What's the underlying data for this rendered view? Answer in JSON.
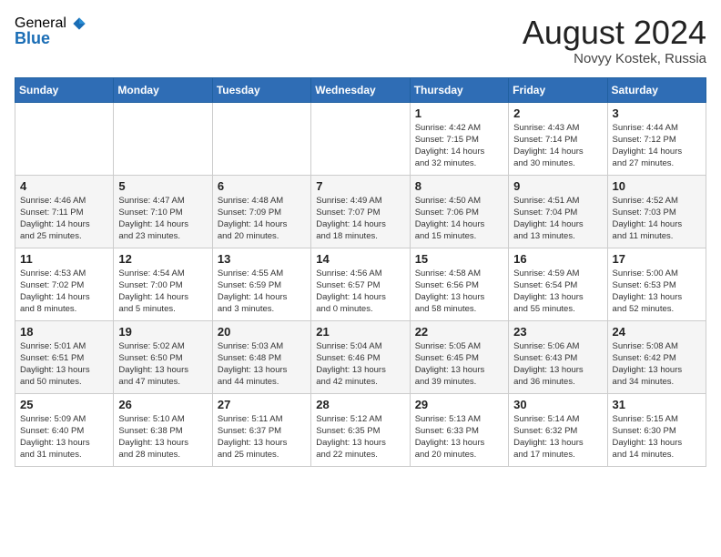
{
  "header": {
    "logo_general": "General",
    "logo_blue": "Blue",
    "month_year": "August 2024",
    "location": "Novyy Kostek, Russia"
  },
  "days_of_week": [
    "Sunday",
    "Monday",
    "Tuesday",
    "Wednesday",
    "Thursday",
    "Friday",
    "Saturday"
  ],
  "weeks": [
    [
      {
        "day": "",
        "detail": ""
      },
      {
        "day": "",
        "detail": ""
      },
      {
        "day": "",
        "detail": ""
      },
      {
        "day": "",
        "detail": ""
      },
      {
        "day": "1",
        "detail": "Sunrise: 4:42 AM\nSunset: 7:15 PM\nDaylight: 14 hours\nand 32 minutes."
      },
      {
        "day": "2",
        "detail": "Sunrise: 4:43 AM\nSunset: 7:14 PM\nDaylight: 14 hours\nand 30 minutes."
      },
      {
        "day": "3",
        "detail": "Sunrise: 4:44 AM\nSunset: 7:12 PM\nDaylight: 14 hours\nand 27 minutes."
      }
    ],
    [
      {
        "day": "4",
        "detail": "Sunrise: 4:46 AM\nSunset: 7:11 PM\nDaylight: 14 hours\nand 25 minutes."
      },
      {
        "day": "5",
        "detail": "Sunrise: 4:47 AM\nSunset: 7:10 PM\nDaylight: 14 hours\nand 23 minutes."
      },
      {
        "day": "6",
        "detail": "Sunrise: 4:48 AM\nSunset: 7:09 PM\nDaylight: 14 hours\nand 20 minutes."
      },
      {
        "day": "7",
        "detail": "Sunrise: 4:49 AM\nSunset: 7:07 PM\nDaylight: 14 hours\nand 18 minutes."
      },
      {
        "day": "8",
        "detail": "Sunrise: 4:50 AM\nSunset: 7:06 PM\nDaylight: 14 hours\nand 15 minutes."
      },
      {
        "day": "9",
        "detail": "Sunrise: 4:51 AM\nSunset: 7:04 PM\nDaylight: 14 hours\nand 13 minutes."
      },
      {
        "day": "10",
        "detail": "Sunrise: 4:52 AM\nSunset: 7:03 PM\nDaylight: 14 hours\nand 11 minutes."
      }
    ],
    [
      {
        "day": "11",
        "detail": "Sunrise: 4:53 AM\nSunset: 7:02 PM\nDaylight: 14 hours\nand 8 minutes."
      },
      {
        "day": "12",
        "detail": "Sunrise: 4:54 AM\nSunset: 7:00 PM\nDaylight: 14 hours\nand 5 minutes."
      },
      {
        "day": "13",
        "detail": "Sunrise: 4:55 AM\nSunset: 6:59 PM\nDaylight: 14 hours\nand 3 minutes."
      },
      {
        "day": "14",
        "detail": "Sunrise: 4:56 AM\nSunset: 6:57 PM\nDaylight: 14 hours\nand 0 minutes."
      },
      {
        "day": "15",
        "detail": "Sunrise: 4:58 AM\nSunset: 6:56 PM\nDaylight: 13 hours\nand 58 minutes."
      },
      {
        "day": "16",
        "detail": "Sunrise: 4:59 AM\nSunset: 6:54 PM\nDaylight: 13 hours\nand 55 minutes."
      },
      {
        "day": "17",
        "detail": "Sunrise: 5:00 AM\nSunset: 6:53 PM\nDaylight: 13 hours\nand 52 minutes."
      }
    ],
    [
      {
        "day": "18",
        "detail": "Sunrise: 5:01 AM\nSunset: 6:51 PM\nDaylight: 13 hours\nand 50 minutes."
      },
      {
        "day": "19",
        "detail": "Sunrise: 5:02 AM\nSunset: 6:50 PM\nDaylight: 13 hours\nand 47 minutes."
      },
      {
        "day": "20",
        "detail": "Sunrise: 5:03 AM\nSunset: 6:48 PM\nDaylight: 13 hours\nand 44 minutes."
      },
      {
        "day": "21",
        "detail": "Sunrise: 5:04 AM\nSunset: 6:46 PM\nDaylight: 13 hours\nand 42 minutes."
      },
      {
        "day": "22",
        "detail": "Sunrise: 5:05 AM\nSunset: 6:45 PM\nDaylight: 13 hours\nand 39 minutes."
      },
      {
        "day": "23",
        "detail": "Sunrise: 5:06 AM\nSunset: 6:43 PM\nDaylight: 13 hours\nand 36 minutes."
      },
      {
        "day": "24",
        "detail": "Sunrise: 5:08 AM\nSunset: 6:42 PM\nDaylight: 13 hours\nand 34 minutes."
      }
    ],
    [
      {
        "day": "25",
        "detail": "Sunrise: 5:09 AM\nSunset: 6:40 PM\nDaylight: 13 hours\nand 31 minutes."
      },
      {
        "day": "26",
        "detail": "Sunrise: 5:10 AM\nSunset: 6:38 PM\nDaylight: 13 hours\nand 28 minutes."
      },
      {
        "day": "27",
        "detail": "Sunrise: 5:11 AM\nSunset: 6:37 PM\nDaylight: 13 hours\nand 25 minutes."
      },
      {
        "day": "28",
        "detail": "Sunrise: 5:12 AM\nSunset: 6:35 PM\nDaylight: 13 hours\nand 22 minutes."
      },
      {
        "day": "29",
        "detail": "Sunrise: 5:13 AM\nSunset: 6:33 PM\nDaylight: 13 hours\nand 20 minutes."
      },
      {
        "day": "30",
        "detail": "Sunrise: 5:14 AM\nSunset: 6:32 PM\nDaylight: 13 hours\nand 17 minutes."
      },
      {
        "day": "31",
        "detail": "Sunrise: 5:15 AM\nSunset: 6:30 PM\nDaylight: 13 hours\nand 14 minutes."
      }
    ]
  ]
}
